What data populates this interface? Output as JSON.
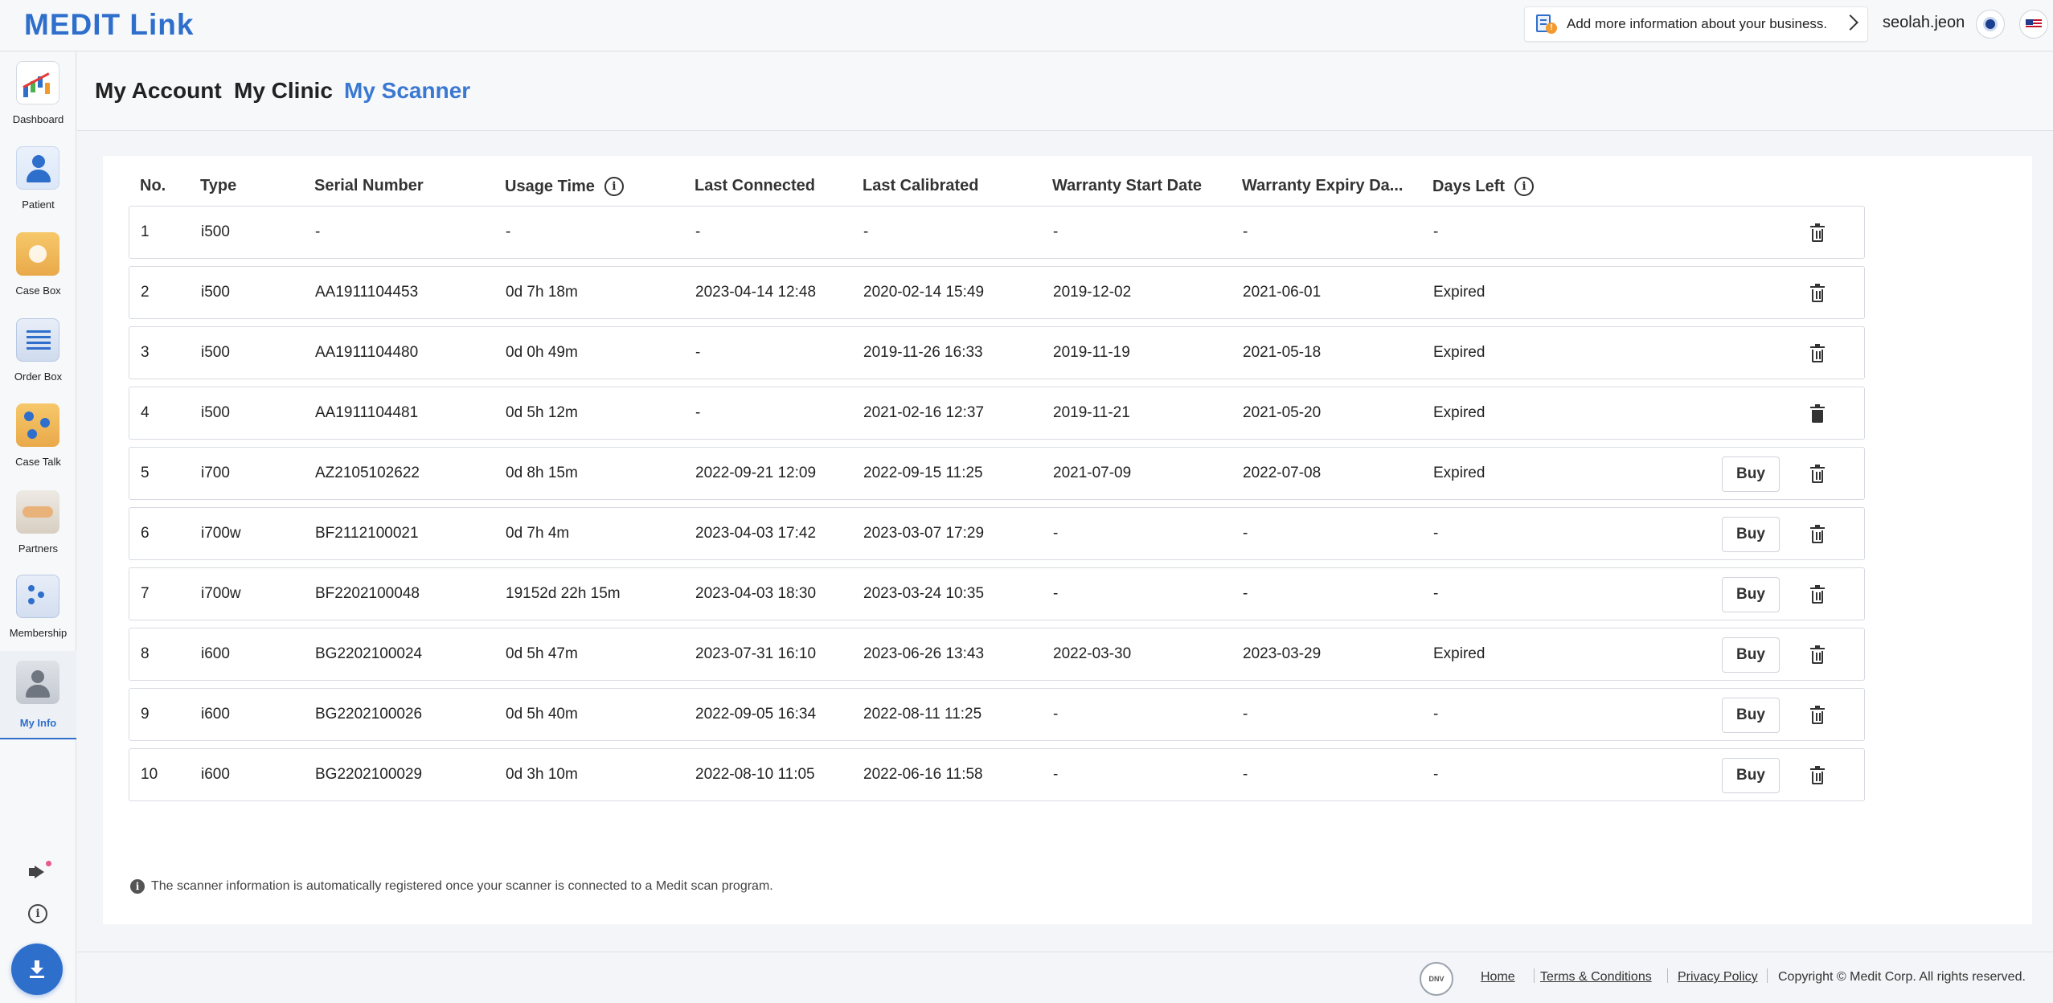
{
  "app": {
    "logo": "MEDIT Link"
  },
  "topbar": {
    "business_banner": "Add more information about your business.",
    "username": "seolah.jeon"
  },
  "sidebar": {
    "items": [
      {
        "label": "Dashboard",
        "icon": "dashboard-icon"
      },
      {
        "label": "Patient",
        "icon": "patient-icon"
      },
      {
        "label": "Case Box",
        "icon": "case-box-icon"
      },
      {
        "label": "Order Box",
        "icon": "order-box-icon"
      },
      {
        "label": "Case Talk",
        "icon": "case-talk-icon"
      },
      {
        "label": "Partners",
        "icon": "partners-icon"
      },
      {
        "label": "Membership",
        "icon": "membership-icon"
      },
      {
        "label": "My Info",
        "icon": "my-info-icon",
        "active": true
      }
    ]
  },
  "tabs": [
    {
      "label": "My Account"
    },
    {
      "label": "My Clinic"
    },
    {
      "label": "My Scanner",
      "active": true
    }
  ],
  "table": {
    "headers": {
      "no": "No.",
      "type": "Type",
      "serial": "Serial Number",
      "usage": "Usage Time",
      "last_connected": "Last Connected",
      "last_calibrated": "Last Calibrated",
      "warranty_start": "Warranty Start Date",
      "warranty_expiry": "Warranty Expiry Da...",
      "days_left": "Days Left"
    },
    "buy_label": "Buy",
    "rows": [
      {
        "no": "1",
        "type": "i500",
        "serial": "-",
        "usage": "-",
        "last_connected": "-",
        "last_calibrated": "-",
        "warranty_start": "-",
        "warranty_expiry": "-",
        "days_left": "-",
        "buy": false
      },
      {
        "no": "2",
        "type": "i500",
        "serial": "AA1911104453",
        "usage": "0d 7h 18m",
        "last_connected": "2023-04-14 12:48",
        "last_calibrated": "2020-02-14 15:49",
        "warranty_start": "2019-12-02",
        "warranty_expiry": "2021-06-01",
        "days_left": "Expired",
        "buy": false
      },
      {
        "no": "3",
        "type": "i500",
        "serial": "AA1911104480",
        "usage": "0d 0h 49m",
        "last_connected": "-",
        "last_calibrated": "2019-11-26 16:33",
        "warranty_start": "2019-11-19",
        "warranty_expiry": "2021-05-18",
        "days_left": "Expired",
        "buy": false
      },
      {
        "no": "4",
        "type": "i500",
        "serial": "AA1911104481",
        "usage": "0d 5h 12m",
        "last_connected": "-",
        "last_calibrated": "2021-02-16 12:37",
        "warranty_start": "2019-11-21",
        "warranty_expiry": "2021-05-20",
        "days_left": "Expired",
        "buy": false
      },
      {
        "no": "5",
        "type": "i700",
        "serial": "AZ2105102622",
        "usage": "0d 8h 15m",
        "last_connected": "2022-09-21 12:09",
        "last_calibrated": "2022-09-15 11:25",
        "warranty_start": "2021-07-09",
        "warranty_expiry": "2022-07-08",
        "days_left": "Expired",
        "buy": true
      },
      {
        "no": "6",
        "type": "i700w",
        "serial": "BF2112100021",
        "usage": "0d 7h 4m",
        "last_connected": "2023-04-03 17:42",
        "last_calibrated": "2023-03-07 17:29",
        "warranty_start": "-",
        "warranty_expiry": "-",
        "days_left": "-",
        "buy": true
      },
      {
        "no": "7",
        "type": "i700w",
        "serial": "BF2202100048",
        "usage": "19152d 22h 15m",
        "last_connected": "2023-04-03 18:30",
        "last_calibrated": "2023-03-24 10:35",
        "warranty_start": "-",
        "warranty_expiry": "-",
        "days_left": "-",
        "buy": true
      },
      {
        "no": "8",
        "type": "i600",
        "serial": "BG2202100024",
        "usage": "0d 5h 47m",
        "last_connected": "2023-07-31 16:10",
        "last_calibrated": "2023-06-26 13:43",
        "warranty_start": "2022-03-30",
        "warranty_expiry": "2023-03-29",
        "days_left": "Expired",
        "buy": true
      },
      {
        "no": "9",
        "type": "i600",
        "serial": "BG2202100026",
        "usage": "0d 5h 40m",
        "last_connected": "2022-09-05 16:34",
        "last_calibrated": "2022-08-11 11:25",
        "warranty_start": "-",
        "warranty_expiry": "-",
        "days_left": "-",
        "buy": true
      },
      {
        "no": "10",
        "type": "i600",
        "serial": "BG2202100029",
        "usage": "0d 3h 10m",
        "last_connected": "2022-08-10 11:05",
        "last_calibrated": "2022-06-16 11:58",
        "warranty_start": "-",
        "warranty_expiry": "-",
        "days_left": "-",
        "buy": true
      }
    ]
  },
  "footnote": "The scanner information is automatically registered once your scanner is connected to a Medit scan program.",
  "footer": {
    "badge": "DNV",
    "links": [
      "Home",
      "Terms & Conditions",
      "Privacy Policy"
    ],
    "copyright": "Copyright © Medit Corp. All rights reserved."
  },
  "colors": {
    "accent": "#2f6fcc",
    "active_tab": "#3a78d1"
  }
}
